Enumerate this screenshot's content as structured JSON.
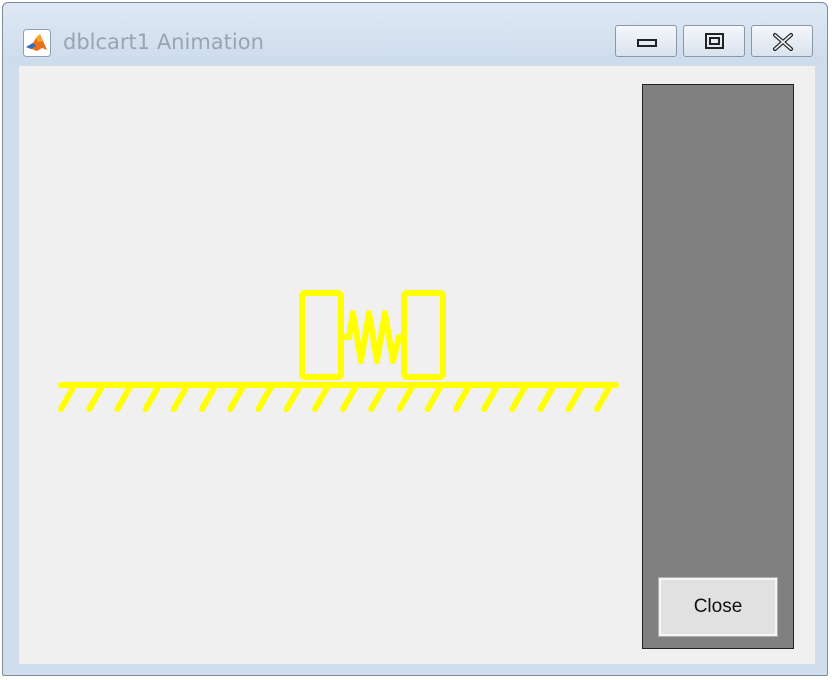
{
  "window": {
    "title": "dblcart1 Animation",
    "app_icon": "matlab-logo-icon",
    "controls": [
      {
        "name": "minimize",
        "icon": "minimize-icon"
      },
      {
        "name": "restore",
        "icon": "restore-icon"
      },
      {
        "name": "close",
        "icon": "close-icon"
      }
    ]
  },
  "animation": {
    "stroke_color": "#ffff00",
    "ground_hatch_count": 20,
    "objects": [
      "cart-left",
      "spring",
      "cart-right",
      "ground"
    ]
  },
  "panel": {
    "background": "#808080",
    "close_label": "Close"
  }
}
